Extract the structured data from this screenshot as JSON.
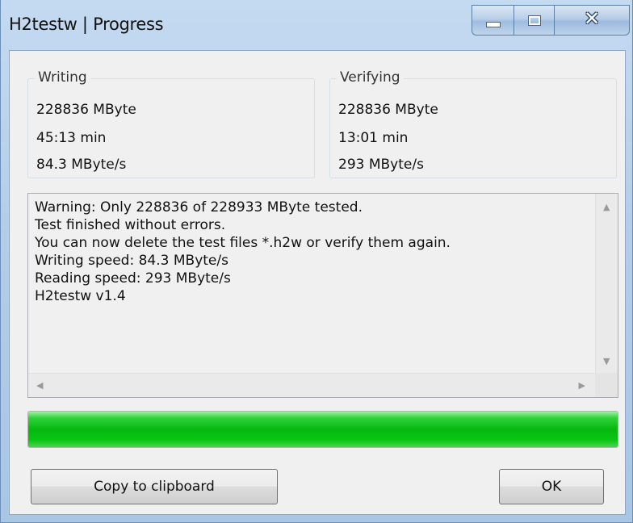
{
  "window": {
    "title": "H2testw | Progress"
  },
  "writing": {
    "title": "Writing",
    "size": "228836 MByte",
    "time": "45:13 min",
    "speed": "84.3 MByte/s"
  },
  "verifying": {
    "title": "Verifying",
    "size": "228836 MByte",
    "time": "13:01 min",
    "speed": "293 MByte/s"
  },
  "log": {
    "lines": [
      "Warning: Only 228836 of 228933 MByte tested.",
      "Test finished without errors.",
      "You can now delete the test files *.h2w or verify them again.",
      "Writing speed: 84.3 MByte/s",
      "Reading speed: 293 MByte/s",
      "H2testw v1.4"
    ]
  },
  "progress": {
    "fraction": 1.0,
    "color": "#06b80f"
  },
  "buttons": {
    "copy_label": "Copy to clipboard",
    "ok_label": "OK"
  },
  "icons": {
    "minimize": "minimize-icon",
    "maximize": "maximize-icon",
    "close": "close-icon",
    "scroll_up": "arrow-up-icon",
    "scroll_down": "arrow-down-icon",
    "scroll_left": "arrow-left-icon",
    "scroll_right": "arrow-right-icon"
  }
}
